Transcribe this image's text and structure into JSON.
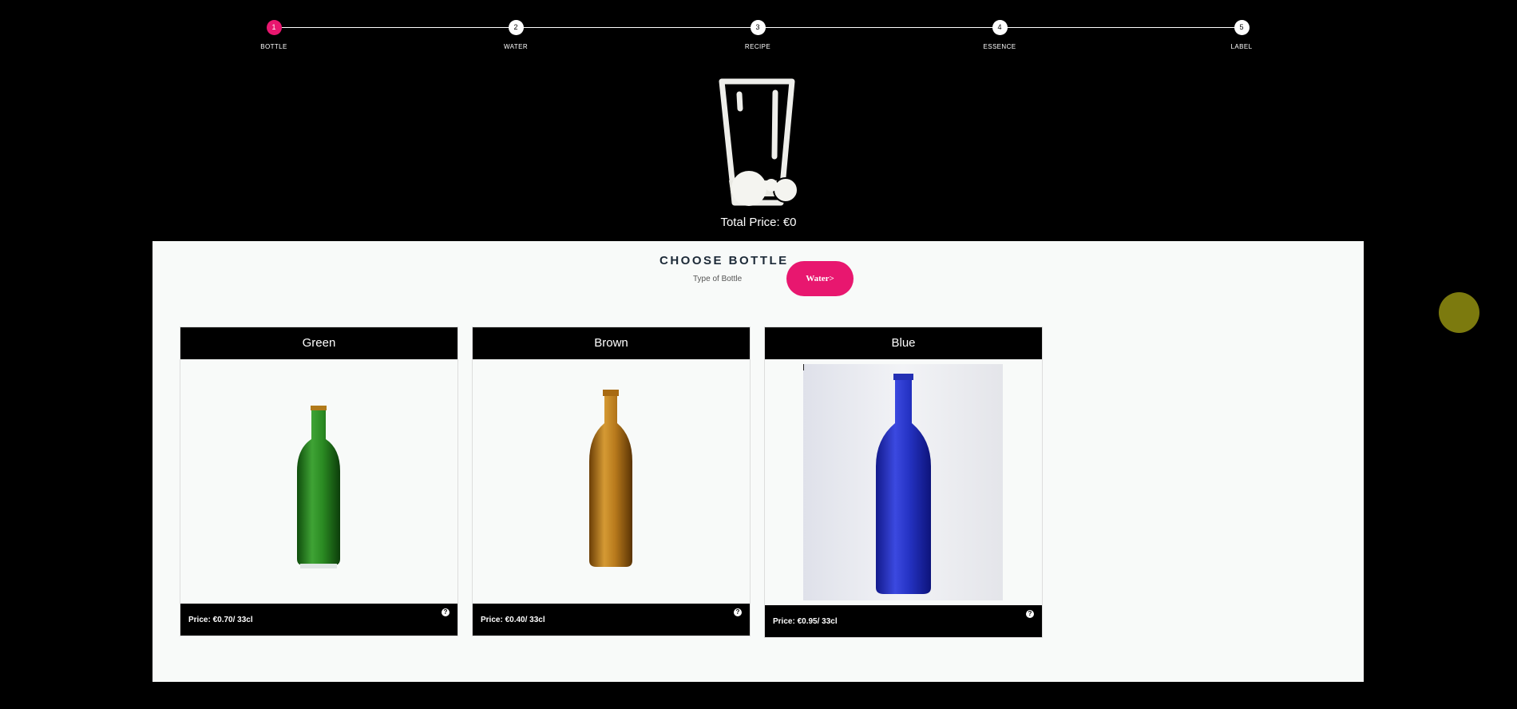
{
  "stepper": {
    "steps": [
      {
        "number": "1",
        "label": "BOTTLE"
      },
      {
        "number": "2",
        "label": "WATER"
      },
      {
        "number": "3",
        "label": "RECIPE"
      },
      {
        "number": "4",
        "label": "ESSENCE"
      },
      {
        "number": "5",
        "label": "LABEL"
      }
    ],
    "active_step": "1",
    "active_color": "#e8176f"
  },
  "summary": {
    "total_price": "Total Price: €0"
  },
  "panel": {
    "title": "CHOOSE BOTTLE",
    "subtitle": "Type of Bottle",
    "next_button": "Water>"
  },
  "bottles": [
    {
      "name": "Green",
      "price": "Price: €0.70/ 33cl",
      "help": "?",
      "color": "#1f7a1a"
    },
    {
      "name": "Brown",
      "price": "Price: €0.40/ 33cl",
      "help": "?",
      "color": "#9a5a0a"
    },
    {
      "name": "Blue",
      "price": "Price: €0.95/ 33cl",
      "help": "?",
      "color": "#1d2ab8"
    }
  ]
}
